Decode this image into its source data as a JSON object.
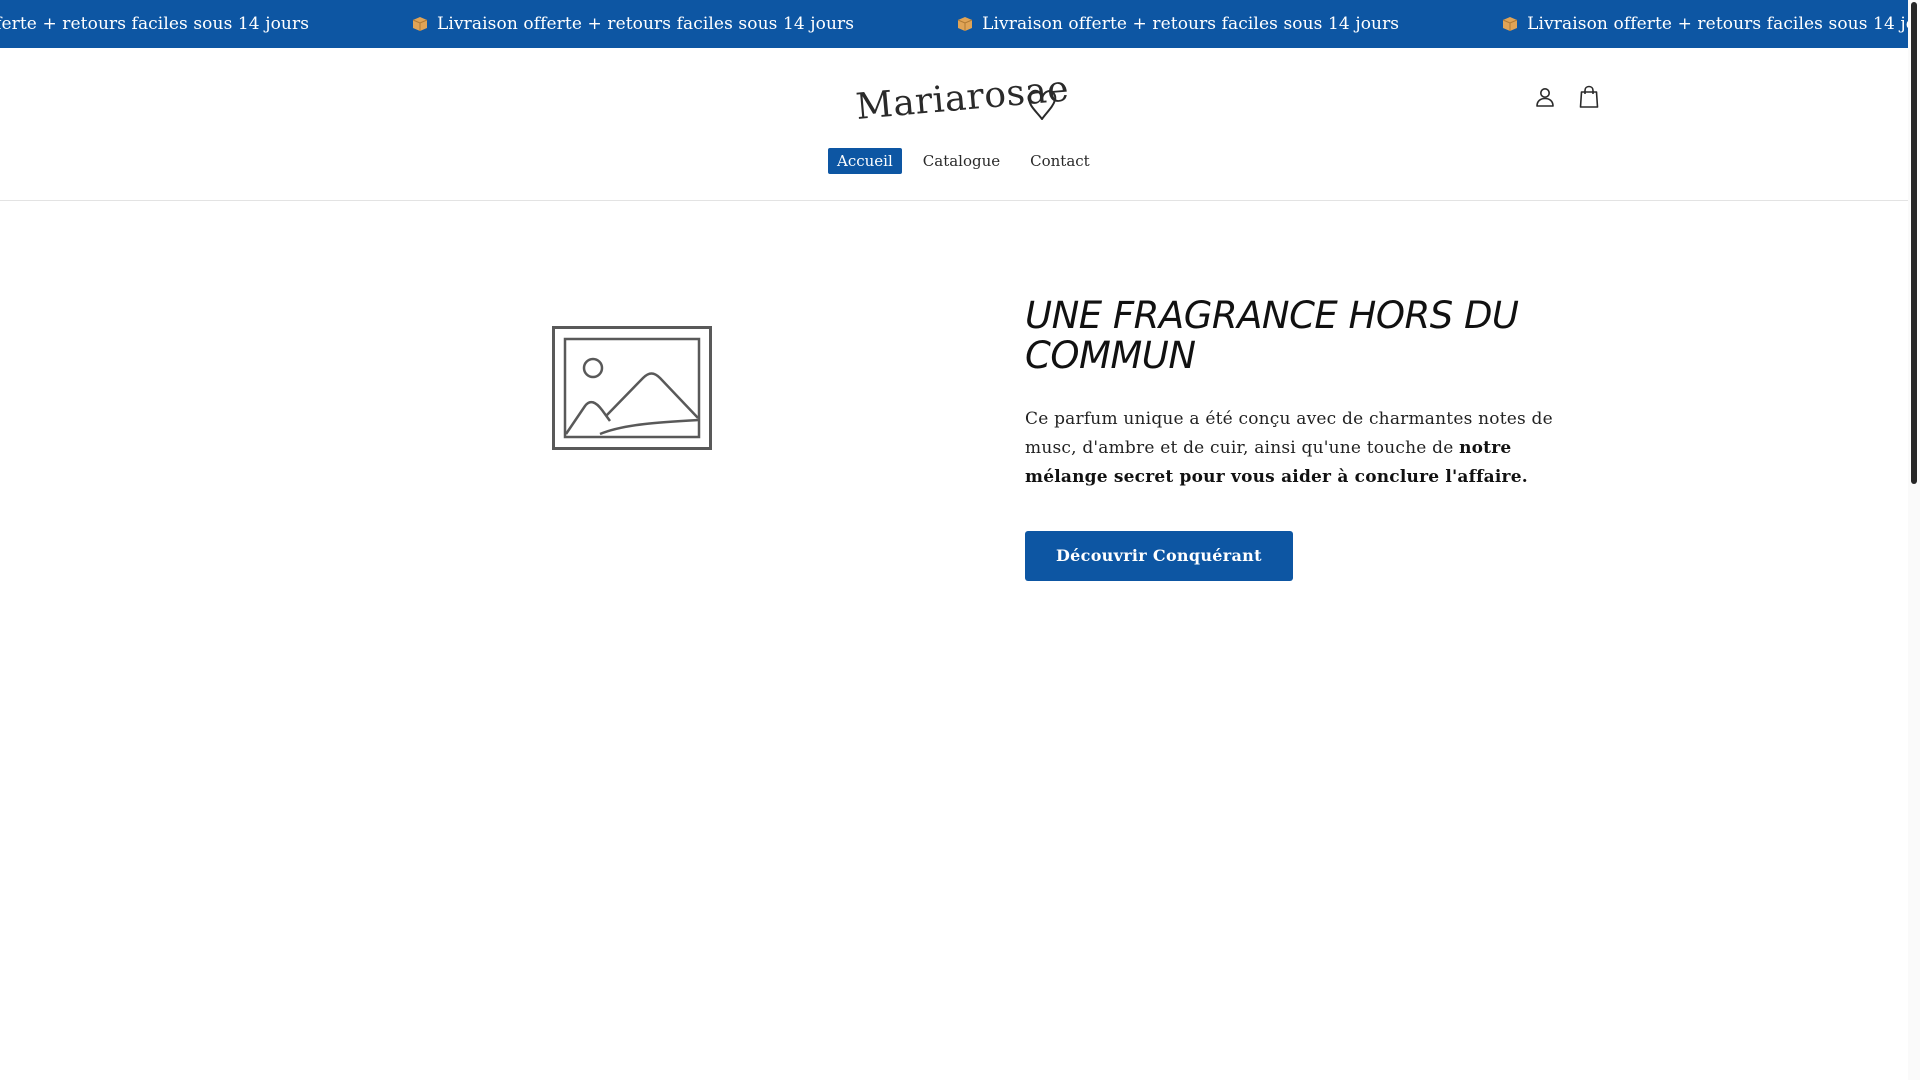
{
  "announcement": {
    "message": "Livraison offerte + retours faciles sous 14 jours",
    "icon": "package-icon",
    "background": "#0d56a3"
  },
  "header": {
    "logo_text": "Mariarosae",
    "nav": [
      {
        "label": "Accueil",
        "active": true
      },
      {
        "label": "Catalogue",
        "active": false
      },
      {
        "label": "Contact",
        "active": false
      }
    ],
    "icons": [
      "account-icon",
      "cart-icon"
    ]
  },
  "main": {
    "image_placeholder": "image-placeholder-icon",
    "title": "UNE FRAGRANCE HORS DU COMMUN",
    "body_intro": "Ce parfum unique a été conçu avec de charmantes notes de musc, d'ambre et de cuir, ainsi qu'une touche de ",
    "body_bold": "notre mélange secret pour vous aider à conclure l'affaire.",
    "cta_label": "Découvrir Conquérant"
  },
  "colors": {
    "accent": "#0d56a3",
    "text": "#1a1a1a"
  }
}
